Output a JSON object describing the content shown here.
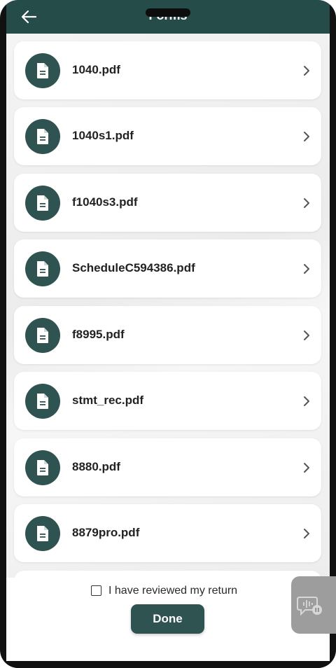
{
  "header": {
    "title": "Forms",
    "back_icon": "arrow-left-icon"
  },
  "files": [
    {
      "name": "1040.pdf"
    },
    {
      "name": "1040s1.pdf"
    },
    {
      "name": "f1040s3.pdf"
    },
    {
      "name": "ScheduleC594386.pdf"
    },
    {
      "name": "f8995.pdf"
    },
    {
      "name": "stmt_rec.pdf"
    },
    {
      "name": "8880.pdf"
    },
    {
      "name": "8879pro.pdf"
    }
  ],
  "footer": {
    "review_label": "I have reviewed my return",
    "review_checked": false,
    "done_label": "Done"
  },
  "colors": {
    "header_bg": "#254c49",
    "accent": "#2f5350",
    "card_bg": "#ffffff",
    "fab_bg": "#9d9d9d"
  },
  "icons": {
    "file": "document-icon",
    "row_chevron": "chevron-right-icon",
    "chat": "chat-voice-icon"
  }
}
